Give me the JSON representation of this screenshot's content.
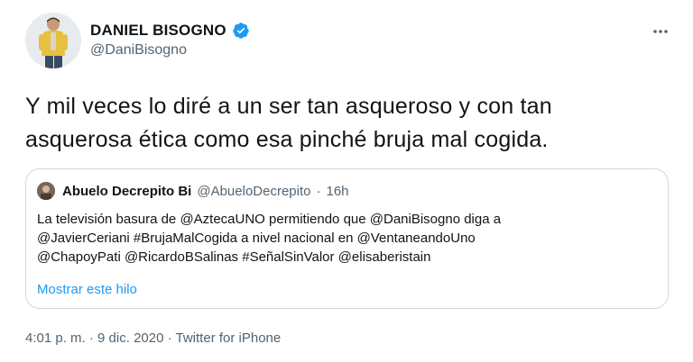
{
  "author": {
    "name": "DANIEL BISOGNO",
    "handle": "@DaniBisogno",
    "verified": true,
    "verified_color": "#1d9bf0"
  },
  "tweet": {
    "text_line1": "Y mil veces lo diré a un ser tan asqueroso y con tan",
    "text_line2": "asquerosa ética como esa pinché bruja mal cogida."
  },
  "quote": {
    "name": "Abuelo Decrepito Bi",
    "handle": "@AbueloDecrepito",
    "separator": "·",
    "time": "16h",
    "text_line1": "La televisión basura de @AztecaUNO permitiendo que @DaniBisogno diga a",
    "text_line2": "@JavierCeriani #BrujaMalCogida a nivel nacional en @VentaneandoUno",
    "text_line3": "@ChapoyPati @RicardoBSalinas #SeñalSinValor @elisaberistain",
    "show_thread": "Mostrar este hilo"
  },
  "meta": {
    "time": "4:01 p. m.",
    "separator1": "·",
    "date": "9 dic. 2020",
    "separator2": "·",
    "source": "Twitter for iPhone"
  },
  "icons": {
    "more": "more-horizontal-icon",
    "verified": "verified-badge-icon"
  },
  "colors": {
    "link": "#1d9bf0",
    "secondary_text": "#536471",
    "border": "#cfd9de"
  }
}
